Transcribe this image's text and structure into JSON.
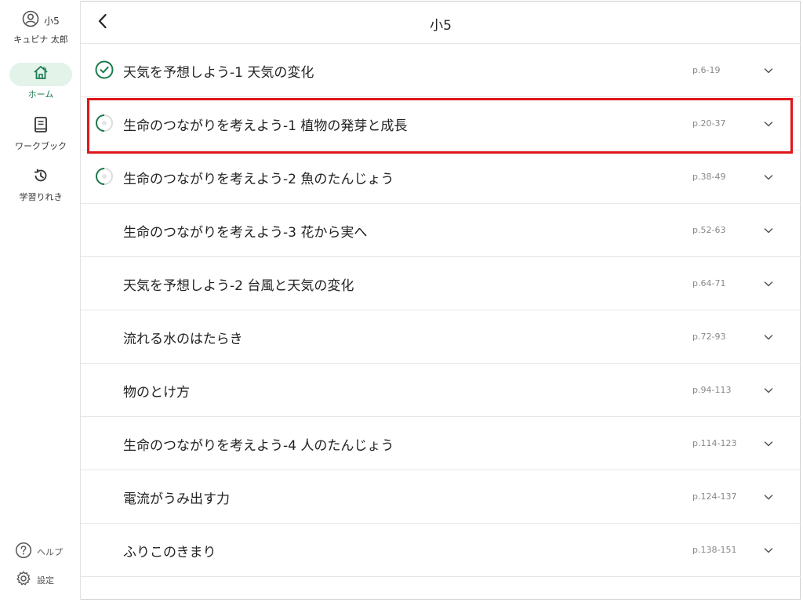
{
  "profile": {
    "grade": "小5",
    "name": "キュピナ 太郎"
  },
  "nav": {
    "home_label": "ホーム",
    "workbook_label": "ワークブック",
    "history_label": "学習りれき"
  },
  "bottom": {
    "help_label": "ヘルプ",
    "settings_label": "設定"
  },
  "header": {
    "title": "小5"
  },
  "units": [
    {
      "title": "天気を予想しよう-1 天気の変化",
      "pages": "p.6-19",
      "status": "complete"
    },
    {
      "title": "生命のつながりを考えよう-1 植物の発芽と成長",
      "pages": "p.20-37",
      "status": "in-progress"
    },
    {
      "title": "生命のつながりを考えよう-2 魚のたんじょう",
      "pages": "p.38-49",
      "status": "in-progress"
    },
    {
      "title": "生命のつながりを考えよう-3 花から実へ",
      "pages": "p.52-63",
      "status": "none"
    },
    {
      "title": "天気を予想しよう-2 台風と天気の変化",
      "pages": "p.64-71",
      "status": "none"
    },
    {
      "title": "流れる水のはたらき",
      "pages": "p.72-93",
      "status": "none"
    },
    {
      "title": "物のとけ方",
      "pages": "p.94-113",
      "status": "none"
    },
    {
      "title": "生命のつながりを考えよう-4 人のたんじょう",
      "pages": "p.114-123",
      "status": "none"
    },
    {
      "title": "電流がうみ出す力",
      "pages": "p.124-137",
      "status": "none"
    },
    {
      "title": "ふりこのきまり",
      "pages": "p.138-151",
      "status": "none"
    }
  ],
  "colors": {
    "accent": "#1b7a4d",
    "active_bg": "#e3f3ea",
    "highlight": "#e0161b"
  },
  "icons": {
    "profile": "user-circle-icon",
    "home": "home-icon",
    "workbook": "book-icon",
    "history": "history-icon",
    "help": "help-icon",
    "settings": "gear-icon",
    "back": "chevron-left-icon",
    "expand": "chevron-down-icon",
    "complete": "check-circle-icon",
    "in_progress": "progress-ring-icon"
  }
}
